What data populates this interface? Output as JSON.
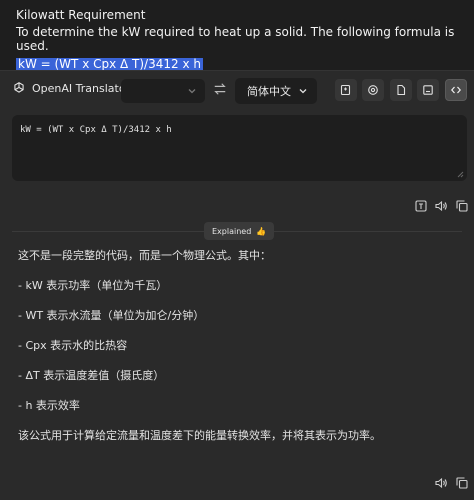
{
  "page": {
    "title": "Kilowatt Requirement",
    "line": "To determine the kW required to heat up a solid. The following formula is used.",
    "selected_text": "kW = (WT x Cpx Δ T)/3412 x h"
  },
  "app": {
    "name": "OpenAI Translator",
    "source_lang": "",
    "target_lang": "简体中文"
  },
  "input": {
    "text": "kW = (WT x Cpx Δ T)/3412 x h"
  },
  "badge": {
    "label": "Explained",
    "emoji": "👍"
  },
  "result": {
    "lines": [
      "这不是一段完整的代码，而是一个物理公式。其中：",
      "- kW 表示功率（单位为千瓦）",
      "- WT 表示水流量（单位为加仑/分钟）",
      "- Cpx 表示水的比热容",
      "- ΔT 表示温度差值（摄氏度）",
      "- h 表示效率",
      "该公式用于计算给定流量和温度差下的能量转换效率，并将其表示为功率。"
    ]
  },
  "colors": {
    "selection": "#3a64d8",
    "panel": "#2a2a2a",
    "input_bg": "#1e1e1e"
  },
  "icons": {
    "brand": "openai-logo-icon",
    "swap": "swap-arrows-icon",
    "toolbar": [
      "add-note-icon",
      "openai-settings-icon",
      "document-icon",
      "save-icon",
      "code-icon"
    ],
    "input_actions": [
      "ocr-icon",
      "speaker-icon",
      "copy-icon"
    ],
    "result_actions": [
      "speaker-icon",
      "copy-icon"
    ]
  }
}
